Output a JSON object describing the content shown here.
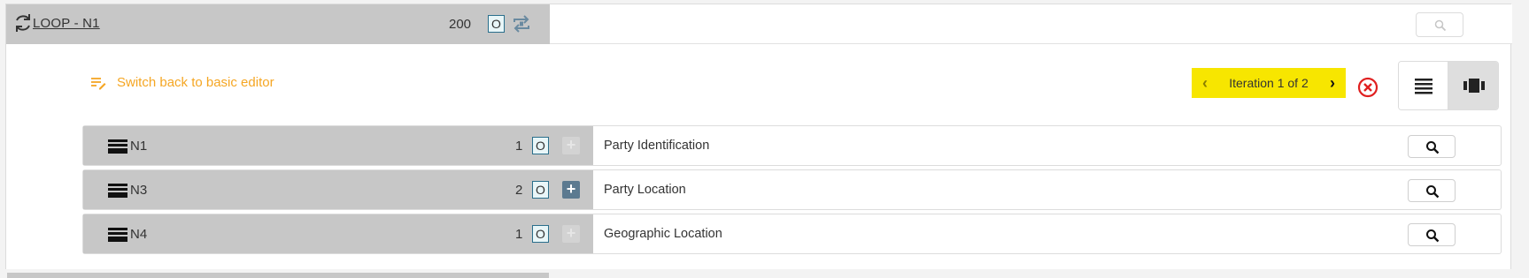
{
  "loop": {
    "title": "LOOP - N1",
    "count": "200",
    "usage": "O"
  },
  "toolbar": {
    "switch_label": "Switch back to basic editor",
    "iteration_label": "Iteration 1 of 2"
  },
  "segments": [
    {
      "name": "N1",
      "count": "1",
      "usage": "O",
      "plus": "+",
      "plus_enabled": false,
      "description": "Party Identification"
    },
    {
      "name": "N3",
      "count": "2",
      "usage": "O",
      "plus": "+",
      "plus_enabled": true,
      "description": "Party Location"
    },
    {
      "name": "N4",
      "count": "1",
      "usage": "O",
      "plus": "+",
      "plus_enabled": false,
      "description": "Geographic Location"
    }
  ],
  "colors": {
    "accent_orange": "#f5a623",
    "iteration_yellow": "#f7e600",
    "close_red": "#e02020",
    "header_gray": "#c7c7c7",
    "plus_blue": "#5c7a90"
  },
  "icons": {
    "loop": "cycle-icon",
    "repeat": "repeat-icon",
    "switch": "edit-list-icon",
    "close": "close-circle-icon",
    "list_view": "list-view-icon",
    "card_view": "card-view-icon",
    "segment": "segment-icon",
    "search": "search-icon"
  }
}
